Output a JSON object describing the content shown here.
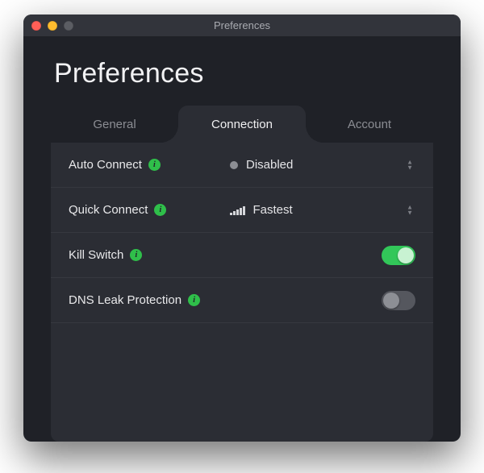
{
  "window": {
    "title": "Preferences"
  },
  "page": {
    "heading": "Preferences"
  },
  "tabs": {
    "general": "General",
    "connection": "Connection",
    "account": "Account",
    "active": "connection"
  },
  "rows": {
    "auto_connect": {
      "label": "Auto Connect",
      "value": "Disabled"
    },
    "quick_connect": {
      "label": "Quick Connect",
      "value": "Fastest"
    },
    "kill_switch": {
      "label": "Kill Switch",
      "enabled": true
    },
    "dns_leak": {
      "label": "DNS Leak Protection",
      "enabled": false
    }
  },
  "colors": {
    "accent_green": "#32c759",
    "window_bg": "#1f2127",
    "panel_bg": "#2b2d34"
  }
}
